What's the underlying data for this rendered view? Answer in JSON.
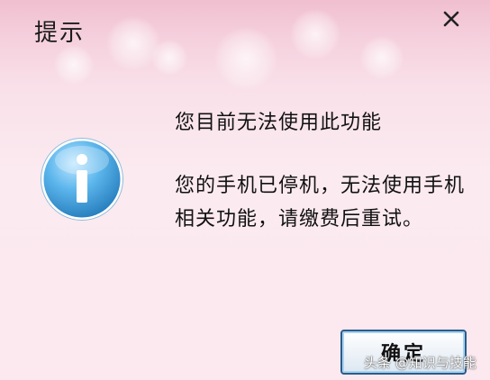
{
  "window": {
    "title": "提示",
    "close_symbol": "✕"
  },
  "icon": {
    "name": "info-icon",
    "glyph": "i",
    "color": "#3a9bd6"
  },
  "message": {
    "headline": "您目前无法使用此功能",
    "body": "您的手机已停机，无法使用手机相关功能，请缴费后重试。"
  },
  "buttons": {
    "ok_label": "确定"
  },
  "watermark": {
    "text": "头条 @知识与技能"
  },
  "colors": {
    "background": "#fbe3ec",
    "button_border": "#2b5c8a"
  }
}
